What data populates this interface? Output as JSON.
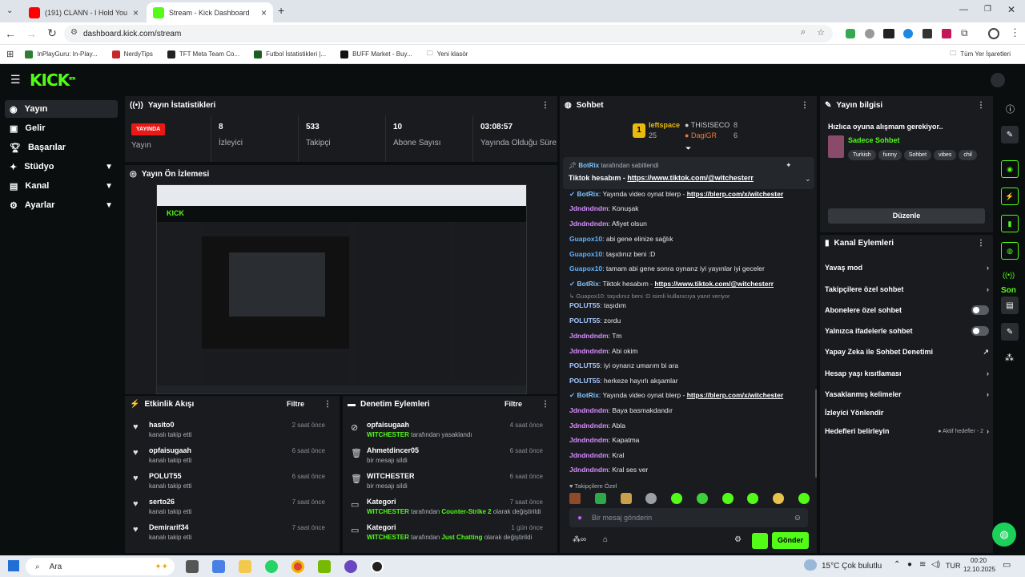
{
  "browser": {
    "tabs": [
      {
        "title": "(191) CLANN - I Hold You - You",
        "active": false,
        "icon_color": "#ff0000"
      },
      {
        "title": "Stream - Kick Dashboard",
        "active": true,
        "icon_color": "#53fc18"
      }
    ],
    "new_tab": "+",
    "url": "dashboard.kick.com/stream",
    "bookmarks": [
      "InPlayGuru: In-Play...",
      "NerdyTips",
      "TFT Meta Team Co...",
      "Futbol İstatistikleri |...",
      "BUFF Market - Buy...",
      "Yeni klasör"
    ],
    "all_bookmarks": "Tüm Yer İşaretleri"
  },
  "kick": {
    "logo": "KICK",
    "logo_sup": "BETA"
  },
  "sidebar": {
    "items": [
      {
        "label": "Yayın",
        "icon": "video-icon",
        "active": true,
        "chevron": false
      },
      {
        "label": "Gelir",
        "icon": "money-icon",
        "active": false,
        "chevron": false
      },
      {
        "label": "Başarılar",
        "icon": "trophy-icon",
        "active": false,
        "chevron": false
      },
      {
        "label": "Stüdyo",
        "icon": "studio-icon",
        "active": false,
        "chevron": true
      },
      {
        "label": "Kanal",
        "icon": "channel-icon",
        "active": false,
        "chevron": true
      },
      {
        "label": "Ayarlar",
        "icon": "gear-icon",
        "active": false,
        "chevron": true
      }
    ]
  },
  "stats": {
    "title": "Yayın İstatistikleri",
    "live_badge": "YAYINDA",
    "live_label": "Yayın",
    "items": [
      {
        "value": "8",
        "label": "İzleyici"
      },
      {
        "value": "533",
        "label": "Takipçi"
      },
      {
        "value": "10",
        "label": "Abone Sayısı"
      },
      {
        "value": "03:08:57",
        "label": "Yayında Olduğu Süre"
      }
    ]
  },
  "preview": {
    "title": "Yayın Ön İzlemesi"
  },
  "activity": {
    "title": "Etkinlik Akışı",
    "filter": "Filtre",
    "rows": [
      {
        "name": "hasito0",
        "sub": "kanalı takip etti",
        "time": "2 saat önce"
      },
      {
        "name": "opfaisugaah",
        "sub": "kanalı takip etti",
        "time": "6 saat önce"
      },
      {
        "name": "POLUT55",
        "sub": "kanalı takip etti",
        "time": "6 saat önce"
      },
      {
        "name": "serto26",
        "sub": "kanalı takip etti",
        "time": "7 saat önce"
      },
      {
        "name": "Demirarif34",
        "sub": "kanalı takip etti",
        "time": "7 saat önce"
      }
    ]
  },
  "moderation": {
    "title": "Denetim Eylemleri",
    "filter": "Filtre",
    "rows": [
      {
        "name": "opfaisugaah",
        "actor": "WITCHESTER",
        "sub": " tarafından yasaklandı",
        "extra": "",
        "extra2": "",
        "time": "4 saat önce",
        "icon": "ban-icon"
      },
      {
        "name": "Ahmetdincer05",
        "actor": "",
        "sub": "bir mesajı sildi",
        "extra": "",
        "extra2": "",
        "time": "6 saat önce",
        "icon": "trash-icon"
      },
      {
        "name": "WITCHESTER",
        "actor": "",
        "sub": "bir mesajı sildi",
        "extra": "",
        "extra2": "",
        "time": "6 saat önce",
        "icon": "trash-icon"
      },
      {
        "name": "Kategori",
        "actor": "WITCHESTER",
        "sub": " tarafından ",
        "extra": "Counter-Strike 2",
        "extra2": " olarak değiştirildi",
        "time": "7 saat önce",
        "icon": "category-icon"
      },
      {
        "name": "Kategori",
        "actor": "WITCHESTER",
        "sub": " tarafından ",
        "extra": "Just Chatting",
        "extra2": " olarak değiştirildi",
        "time": "1 gün önce",
        "icon": "category-icon"
      }
    ]
  },
  "chat": {
    "title": "Sohbet",
    "leaderboard": [
      {
        "rank": "1",
        "name": "leftspace",
        "value": "25"
      },
      {
        "rank": "",
        "name": "THISISECO",
        "value": "8"
      },
      {
        "rank": "",
        "name": "DagiGR",
        "value": "6"
      }
    ],
    "pinned": {
      "user": "BotRix",
      "label": " tarafından sabitlendi",
      "text": "Tiktok hesabım - ",
      "link": "https://www.tiktok.com/@witchesterr"
    },
    "messages": [
      {
        "user": "BotRix",
        "cls": "u-b",
        "text": "Yayında video oynat blerp - ",
        "link": "https://blerp.com/x/witchester",
        "bot": true
      },
      {
        "user": "Jdndndndm",
        "cls": "u-j",
        "text": "Konuşak",
        "link": "",
        "bot": false
      },
      {
        "user": "Jdndndndm",
        "cls": "u-j",
        "text": "Afiyet olsun",
        "link": "",
        "bot": false
      },
      {
        "user": "Guapox10",
        "cls": "u-g",
        "text": "abi gene elinize sağlık",
        "link": "",
        "bot": false
      },
      {
        "user": "Guapox10",
        "cls": "u-g",
        "text": "taşıdınız beni :D",
        "link": "",
        "bot": false
      },
      {
        "user": "Guapox10",
        "cls": "u-g",
        "text": "tamam abi gene sonra oynarız iyi yayınlar iyi geceler",
        "link": "",
        "bot": false
      },
      {
        "user": "BotRix",
        "cls": "u-b",
        "text": "Tiktok hesabım - ",
        "link": "https://www.tiktok.com/@witchesterr",
        "bot": true
      },
      {
        "user": "POLUT55",
        "cls": "u-p",
        "text": "taşıdım",
        "link": "",
        "bot": false,
        "reply": "↳ Guapox10: taşıdınız beni :D isimli kullanıcıya yanıt veriyor"
      },
      {
        "user": "POLUT55",
        "cls": "u-p",
        "text": "zordu",
        "link": "",
        "bot": false
      },
      {
        "user": "Jdndndndm",
        "cls": "u-j",
        "text": "Tm",
        "link": "",
        "bot": false
      },
      {
        "user": "Jdndndndm",
        "cls": "u-j",
        "text": "Abi okim",
        "link": "",
        "bot": false
      },
      {
        "user": "POLUT55",
        "cls": "u-p",
        "text": "iyi oynarız umarım bi ara",
        "link": "",
        "bot": false
      },
      {
        "user": "POLUT55",
        "cls": "u-p",
        "text": "herkeze hayırlı akşamlar",
        "link": "",
        "bot": false
      },
      {
        "user": "BotRix",
        "cls": "u-b",
        "text": "Yayında video oynat blerp - ",
        "link": "https://blerp.com/x/witchester",
        "bot": true
      },
      {
        "user": "Jdndndndm",
        "cls": "u-j",
        "text": "Baya basmakdandır",
        "link": "",
        "bot": false
      },
      {
        "user": "Jdndndndm",
        "cls": "u-j",
        "text": "Abla",
        "link": "",
        "bot": false
      },
      {
        "user": "Jdndndndm",
        "cls": "u-j",
        "text": "Kapatma",
        "link": "",
        "bot": false
      },
      {
        "user": "Jdndndndm",
        "cls": "u-j",
        "text": "Kral",
        "link": "",
        "bot": false
      },
      {
        "user": "Jdndndndm",
        "cls": "u-j",
        "text": "Kral ses ver",
        "link": "",
        "bot": false
      }
    ],
    "followers_only": "♥ Takipçilere Özel",
    "input_placeholder": "Bir mesaj gönderin",
    "send": "Gönder"
  },
  "stream_info": {
    "title": "Yayın bilgisi",
    "stream_title": "Hızlıca oyuna alışmam gerekiyor..",
    "category": "Sadece Sohbet",
    "tags": [
      "Turkish",
      "funny",
      "Sohbet",
      "vibes",
      "chil"
    ],
    "edit": "Düzenle"
  },
  "channel_actions": {
    "title": "Kanal Eylemleri",
    "rows": [
      {
        "label": "Yavaş mod",
        "right": "chevron"
      },
      {
        "label": "Takipçilere özel sohbet",
        "right": "chevron"
      },
      {
        "label": "Abonelere özel sohbet",
        "right": "toggle"
      },
      {
        "label": "Yalnızca ifadelerle sohbet",
        "right": "toggle"
      },
      {
        "label": "Yapay Zeka ile Sohbet Denetimi",
        "right": "external"
      },
      {
        "label": "Hesap yaşı kısıtlaması",
        "right": "chevron"
      },
      {
        "label": "Yasaklanmış kelimeler",
        "right": "chevron"
      },
      {
        "label": "İzleyici Yönlendir",
        "right": "none"
      },
      {
        "label": "Hedefleri belirleyin",
        "right": "goals",
        "note": "● Aktif hedefler - 2"
      }
    ]
  },
  "rail": {
    "label": "Son"
  },
  "taskbar": {
    "search": "Ara",
    "weather": "15°C  Çok bulutlu",
    "lang": "TUR",
    "time": "00:20",
    "date": "12.10.2025"
  }
}
